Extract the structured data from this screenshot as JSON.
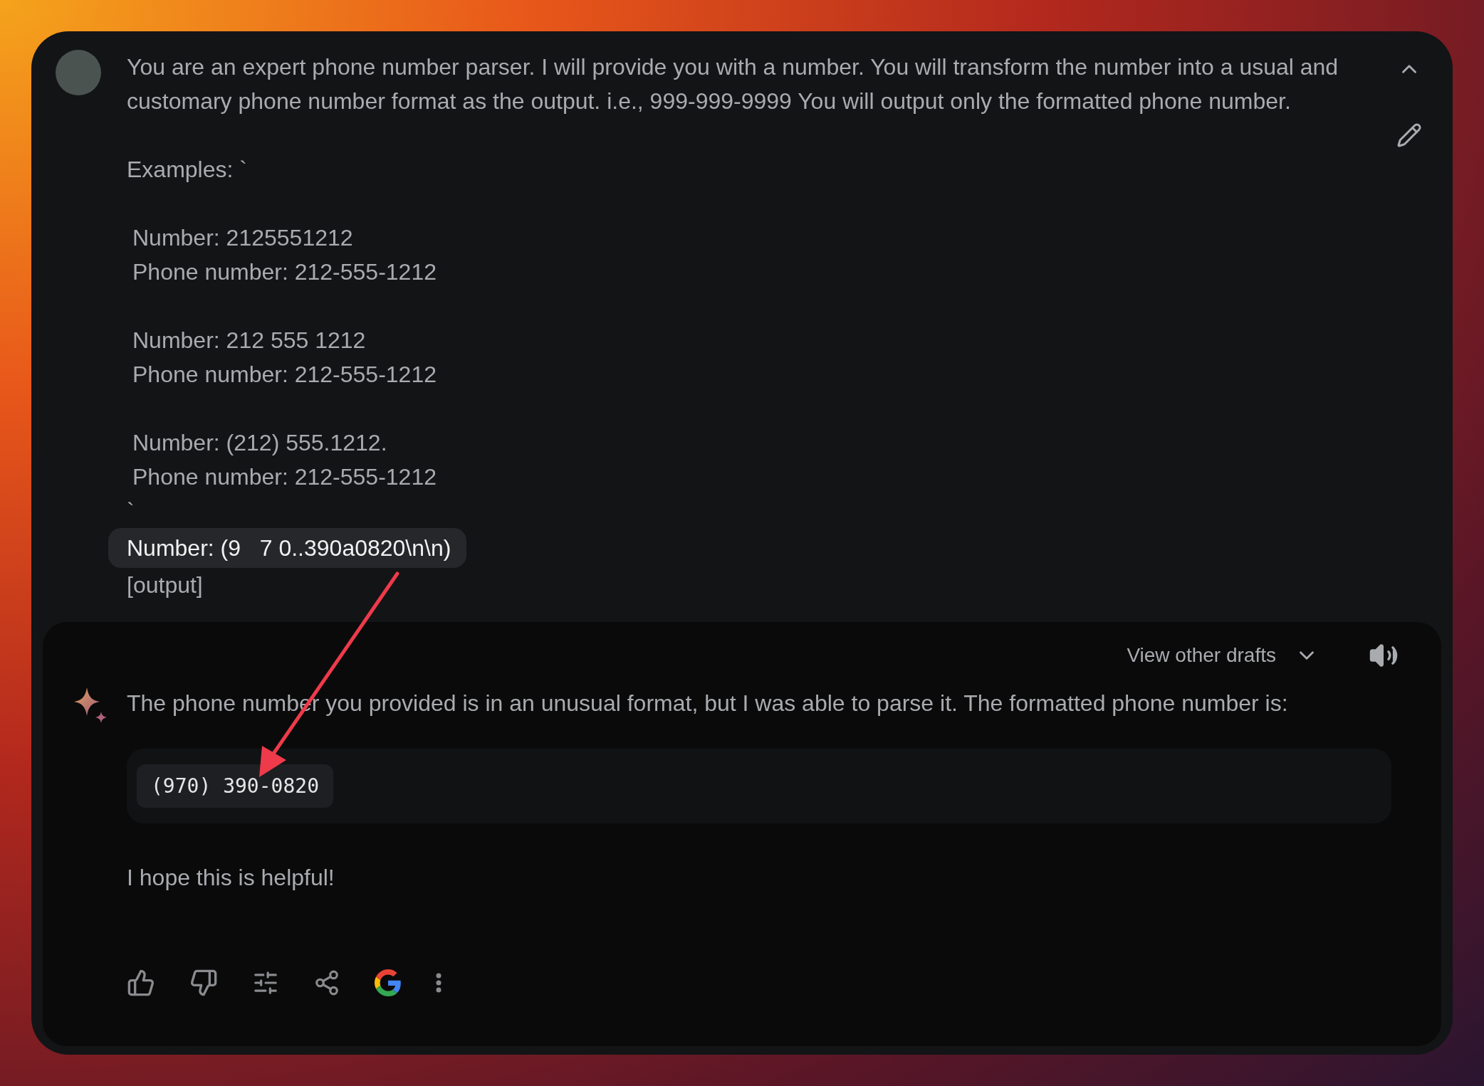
{
  "prompt": {
    "lines": [
      {
        "kind": "text",
        "text": "You are an expert phone number parser. I will provide you with a number. You will transform the number into a usual and customary phone number format as the output. i.e., 999-999-9999 You will output only the formatted phone number."
      },
      {
        "kind": "blank"
      },
      {
        "kind": "text",
        "text": "Examples: `"
      },
      {
        "kind": "blank"
      },
      {
        "kind": "example",
        "text": "Number: 2125551212"
      },
      {
        "kind": "example",
        "text": "Phone number: 212-555-1212"
      },
      {
        "kind": "blank"
      },
      {
        "kind": "example",
        "text": "Number: 212 555 1212"
      },
      {
        "kind": "example",
        "text": "Phone number: 212-555-1212"
      },
      {
        "kind": "blank"
      },
      {
        "kind": "example",
        "text": "Number: (212) 555.1212."
      },
      {
        "kind": "example",
        "text": "Phone number: 212-555-1212"
      },
      {
        "kind": "text",
        "text": "`"
      },
      {
        "kind": "highlight",
        "text": "Number: (9   7 0..390a0820\\n\\n)"
      },
      {
        "kind": "text",
        "text": "[output]"
      }
    ]
  },
  "response": {
    "drafts_label": "View other drafts",
    "intro": "The phone number you provided is in an unusual format, but I was able to parse it. The formatted phone number is:",
    "code": "(970) 390-0820",
    "closing": "I hope this is helpful!"
  }
}
